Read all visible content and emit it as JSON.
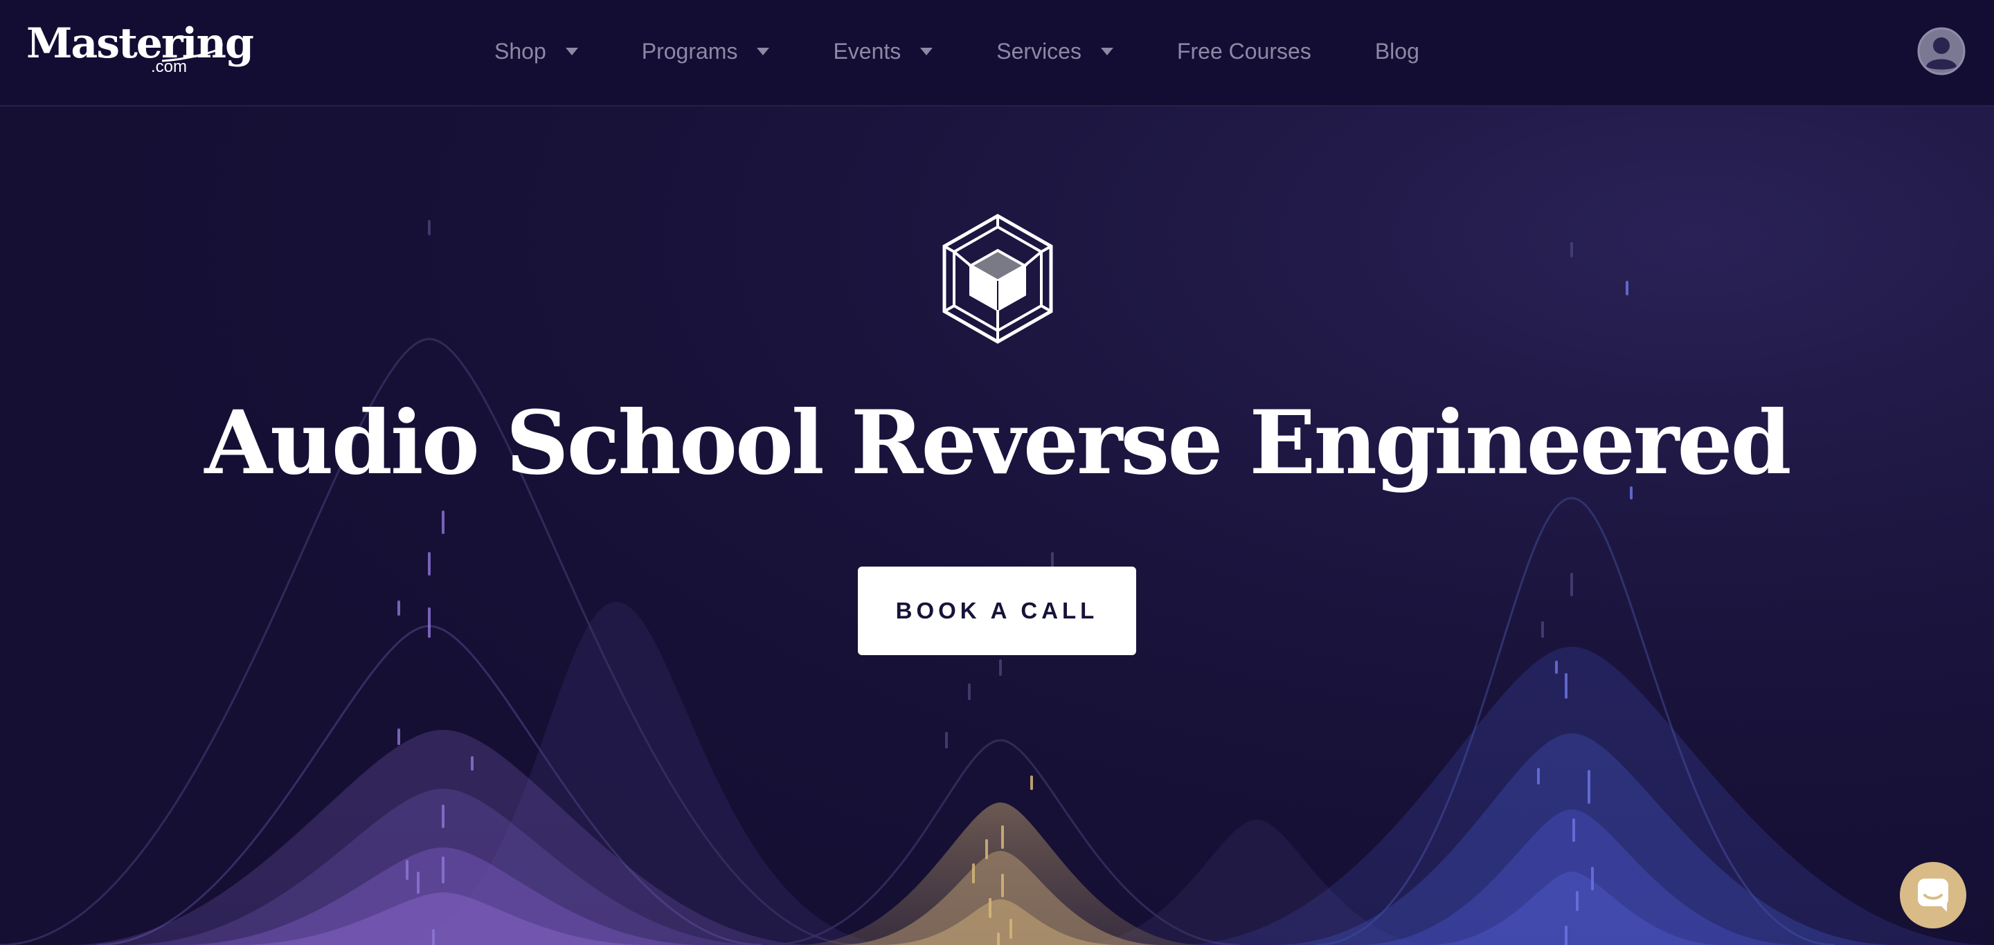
{
  "brand": {
    "name": "Mastering",
    "suffix": ".com",
    "logo_icon": "mastering-wordmark"
  },
  "nav": {
    "items": [
      {
        "label": "Shop",
        "has_dropdown": true
      },
      {
        "label": "Programs",
        "has_dropdown": true
      },
      {
        "label": "Events",
        "has_dropdown": true
      },
      {
        "label": "Services",
        "has_dropdown": true
      },
      {
        "label": "Free Courses",
        "has_dropdown": false
      },
      {
        "label": "Blog",
        "has_dropdown": false
      }
    ],
    "account_icon": "user-avatar-icon"
  },
  "hero": {
    "emblem_icon": "hexagon-cube-icon",
    "title": "Audio School Reverse Engineered",
    "cta_label": "BOOK A CALL",
    "background": "audio-waveform-peaks"
  },
  "chat_widget": {
    "icon": "chat-bubble-icon"
  },
  "colors": {
    "background": "#150f34",
    "nav_text": "#8d88a6",
    "accent_purple": "#8a6ad0",
    "accent_gold": "#d8bb86",
    "accent_blue": "#4a54c8",
    "button_bg": "#ffffff",
    "button_text": "#16133a"
  }
}
